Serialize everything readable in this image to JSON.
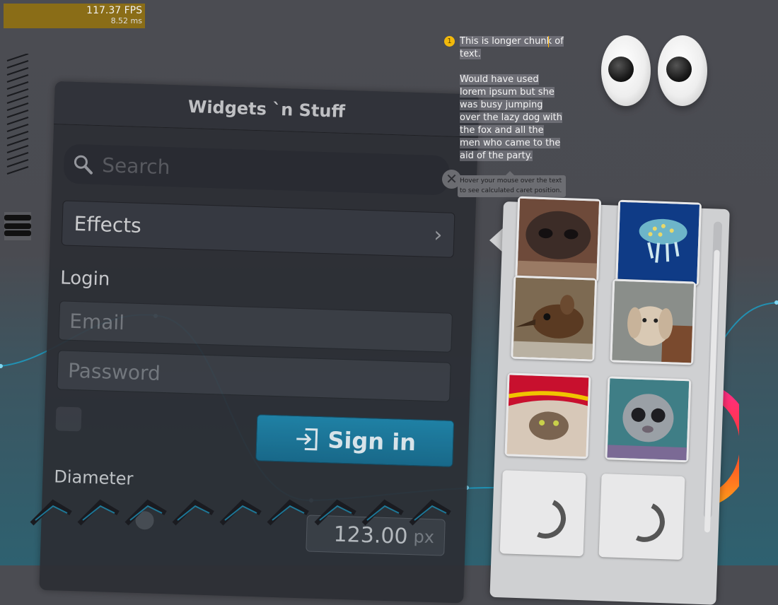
{
  "perf": {
    "fps": "117.37 FPS",
    "ms": "8.52 ms"
  },
  "panel": {
    "title": "Widgets `n Stuff",
    "search_placeholder": "Search",
    "effects_label": "Effects",
    "login_label": "Login",
    "email_placeholder": "Email",
    "password_placeholder": "Password",
    "signin_label": "Sign in",
    "diameter_label": "Diameter",
    "diameter_value": "123.00",
    "diameter_unit": "px",
    "slider_fraction": 0.35
  },
  "text_chunk": {
    "badge": "1",
    "para1": "This is longer chunk of text.",
    "para2": "Would have used lorem ipsum but she    was busy jumping over the lazy dog with the fox and all the men who came to the aid of the party."
  },
  "tooltip": "Hover your mouse over the text to see calculated caret position.",
  "images": [
    {
      "name": "dog-nose-image"
    },
    {
      "name": "jellyfish-image"
    },
    {
      "name": "elephant-shrew-image"
    },
    {
      "name": "bunny-image"
    },
    {
      "name": "kitten-image"
    },
    {
      "name": "baby-owl-monkey-image"
    },
    {
      "name": "loading-spinner-image"
    },
    {
      "name": "loading-spinner-image"
    }
  ],
  "colors": {
    "accent_blue": "#1e84aa",
    "fps_bar": "#8a6d17",
    "badge_yellow": "#f2b90b"
  }
}
